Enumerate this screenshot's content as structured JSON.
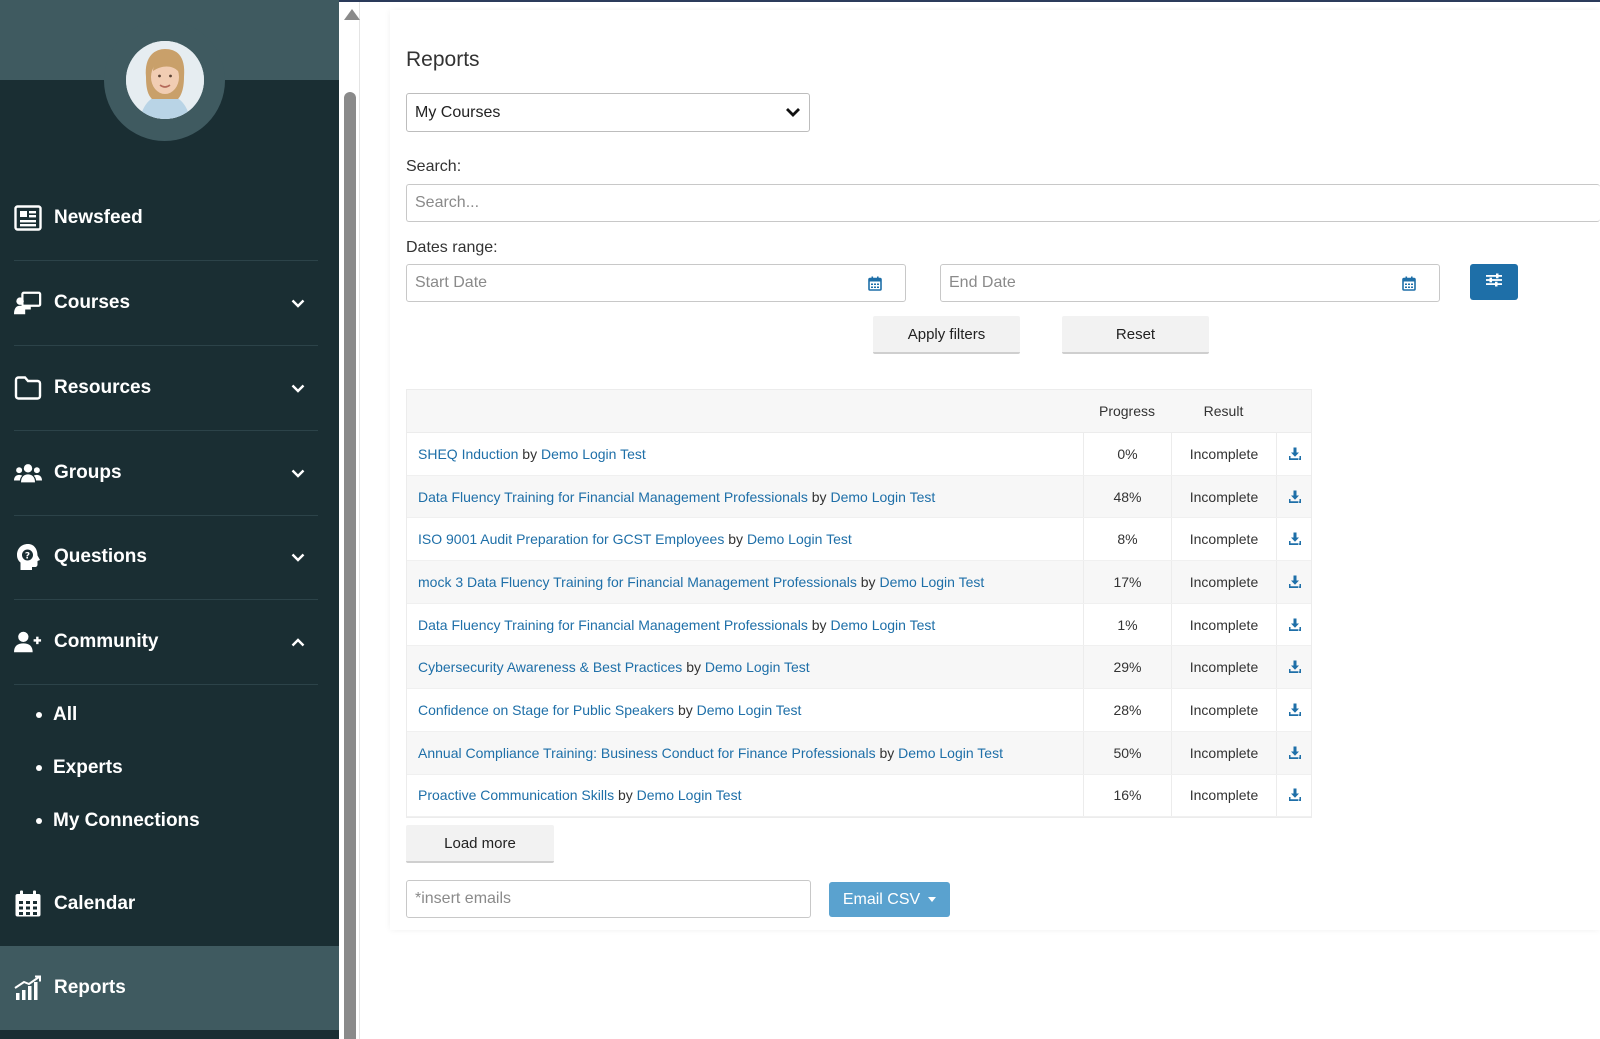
{
  "sidebar": {
    "items": [
      {
        "label": "Newsfeed",
        "icon": "newspaper-icon"
      },
      {
        "label": "Courses",
        "icon": "chalkboard-teacher-icon"
      },
      {
        "label": "Resources",
        "icon": "folder-icon"
      },
      {
        "label": "Groups",
        "icon": "users-icon"
      },
      {
        "label": "Questions",
        "icon": "head-question-icon"
      },
      {
        "label": "Community",
        "icon": "user-plus-icon"
      },
      {
        "label": "Calendar",
        "icon": "calendar-grid-icon"
      },
      {
        "label": "Reports",
        "icon": "chart-growth-icon"
      }
    ],
    "community_sub": [
      "All",
      "Experts",
      "My Connections"
    ],
    "active": "Reports"
  },
  "main": {
    "title": "Reports",
    "report_type": "My Courses",
    "search_label": "Search:",
    "search_placeholder": "Search...",
    "dates_label": "Dates range:",
    "start_placeholder": "Start Date",
    "end_placeholder": "End Date",
    "apply_label": "Apply filters",
    "reset_label": "Reset",
    "load_more_label": "Load more",
    "emails_placeholder": "*insert emails",
    "email_csv_label": "Email CSV"
  },
  "table": {
    "headers": {
      "progress": "Progress",
      "result": "Result"
    },
    "by_word": "by",
    "rows": [
      {
        "course": "SHEQ Induction",
        "author": "Demo Login Test",
        "progress": "0%",
        "result": "Incomplete"
      },
      {
        "course": "Data Fluency Training for Financial Management Professionals",
        "author": "Demo Login Test",
        "progress": "48%",
        "result": "Incomplete"
      },
      {
        "course": "ISO 9001 Audit Preparation for GCST Employees",
        "author": "Demo Login Test",
        "progress": "8%",
        "result": "Incomplete"
      },
      {
        "course": "mock 3 Data Fluency Training for Financial Management Professionals",
        "author": "Demo Login Test",
        "progress": "17%",
        "result": "Incomplete"
      },
      {
        "course": "Data Fluency Training for Financial Management Professionals",
        "author": "Demo Login Test",
        "progress": "1%",
        "result": "Incomplete"
      },
      {
        "course": "Cybersecurity Awareness & Best Practices",
        "author": "Demo Login Test",
        "progress": "29%",
        "result": "Incomplete"
      },
      {
        "course": "Confidence on Stage for Public Speakers",
        "author": "Demo Login Test",
        "progress": "28%",
        "result": "Incomplete"
      },
      {
        "course": "Annual Compliance Training: Business Conduct for Finance Professionals",
        "author": "Demo Login Test",
        "progress": "50%",
        "result": "Incomplete"
      },
      {
        "course": "Proactive Communication Skills",
        "author": "Demo Login Test",
        "progress": "16%",
        "result": "Incomplete"
      }
    ]
  },
  "colors": {
    "sidebar_bg": "#1a2e33",
    "sidebar_active": "#3f5a60",
    "link": "#1e6fa8",
    "email_button": "#5aa2cf"
  }
}
